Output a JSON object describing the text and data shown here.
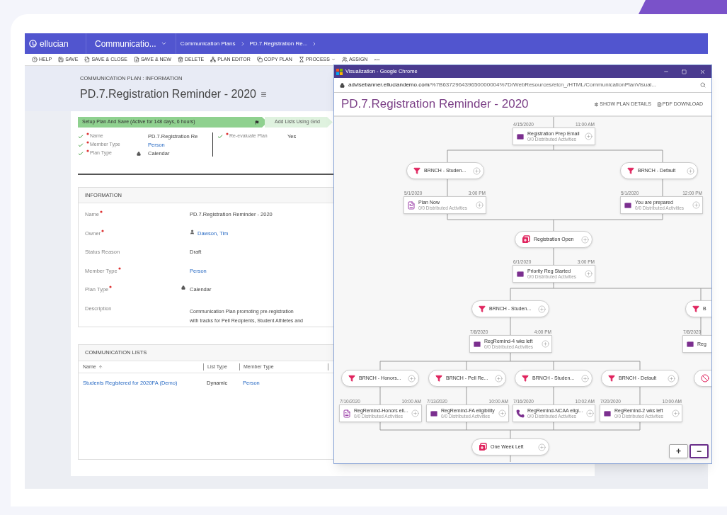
{
  "app": {
    "brand": "ellucian",
    "area": "Communicatio...",
    "breadcrumbs": [
      "Communication Plans",
      "PD.7.Registration Re..."
    ]
  },
  "toolbar": [
    {
      "label": "HELP",
      "kind": "help"
    },
    {
      "label": "SAVE",
      "kind": "save"
    },
    {
      "label": "SAVE & CLOSE",
      "kind": "save-close"
    },
    {
      "label": "SAVE & NEW",
      "kind": "save-new"
    },
    {
      "label": "DELETE",
      "kind": "delete"
    },
    {
      "label": "PLAN EDITOR",
      "kind": "editor"
    },
    {
      "label": "COPY PLAN",
      "kind": "copy"
    },
    {
      "label": "PROCESS",
      "kind": "process"
    },
    {
      "label": "ASSIGN",
      "kind": "assign"
    },
    {
      "kind": "more"
    }
  ],
  "header": {
    "entity": "COMMUNICATION PLAN : INFORMATION",
    "title": "PD.7.Registration Reminder - 2020"
  },
  "process": {
    "stages": [
      {
        "label": "Setup Plan And Save (Active for 148 days, 6 hours)",
        "selected": true
      },
      {
        "label": "Add Lists Using Grid",
        "selected": false
      }
    ],
    "fields": [
      {
        "label": "Name",
        "value": "PD.7.Registration Re",
        "kind": "text",
        "complete": true,
        "required": true
      },
      {
        "label": "Member Type",
        "value": "Person",
        "kind": "link",
        "complete": true,
        "required": true
      },
      {
        "label": "Plan Type",
        "value": "Calendar",
        "kind": "locked",
        "complete": true,
        "required": true
      },
      {
        "label": "Re-evaluate Plan",
        "value": "Yes",
        "kind": "text",
        "complete": true,
        "required": true
      }
    ]
  },
  "information": {
    "title": "INFORMATION",
    "fields": [
      {
        "label": "Name",
        "required": true,
        "kind": "text",
        "lines": [
          "PD.7.Registration Reminder - 2020"
        ]
      },
      {
        "label": "Owner",
        "required": true,
        "kind": "user",
        "lines": [
          "Dawson, Tim"
        ]
      },
      {
        "label": "Status Reason",
        "required": false,
        "kind": "text",
        "lines": [
          "Draft"
        ]
      },
      {
        "label": "Member Type",
        "required": true,
        "kind": "link",
        "lines": [
          "Person"
        ]
      },
      {
        "label": "Plan Type",
        "required": true,
        "kind": "locked",
        "lines": [
          "Calendar"
        ]
      },
      {
        "label": "Description",
        "required": false,
        "kind": "multiline",
        "lines": [
          "Communication Plan promoting pre-registration",
          "with tracks for Pell Recipients, Student Athletes and"
        ]
      }
    ]
  },
  "lists": {
    "title": "COMMUNICATION LISTS",
    "columns": [
      "Name",
      "List Type",
      "Member Type"
    ],
    "rows": [
      {
        "cells": [
          {
            "text": "Students Registered for 2020FA (Demo)",
            "kind": "link"
          },
          {
            "text": "Dynamic",
            "kind": "text"
          },
          {
            "text": "Person",
            "kind": "link"
          }
        ]
      }
    ]
  },
  "popup": {
    "window_title": "Visualization - Google Chrome",
    "url_domain": "advisebanner.elluciandemo.com",
    "url_path": "/%7B637296439650000004%7D/WebResources/elcn_/HTML/CommunicationPlanVisual...",
    "title": "PD.7.Registration Reminder - 2020",
    "actions": [
      {
        "label": "SHOW PLAN DETAILS",
        "kind": "settings"
      },
      {
        "label": "PDF DOWNLOAD",
        "kind": "pdf"
      }
    ],
    "nodes": [
      {
        "kind": "email",
        "label": "Registration Prep Email",
        "sub": "0/0 Distributed Activities",
        "date": "4/15/2020",
        "time": "11:00 AM"
      },
      {
        "kind": "branch",
        "label": "BRNCH - Studen..."
      },
      {
        "kind": "branch",
        "label": "BRNCH - Default"
      },
      {
        "kind": "letter",
        "label": "Plan Now",
        "sub": "0/0 Distributed Activities",
        "date": "5/1/2020",
        "time": "3:00 PM"
      },
      {
        "kind": "email",
        "label": "You are prepared",
        "sub": "0/0 Distributed Activities",
        "date": "5/1/2020",
        "time": "12:00 PM"
      },
      {
        "kind": "milestone",
        "label": "Registration Open"
      },
      {
        "kind": "email",
        "label": "Priority Reg Started",
        "sub": "0/0 Distributed Activities",
        "date": "6/1/2020",
        "time": "3:00 PM"
      },
      {
        "kind": "branch",
        "label": "BRNCH - Studen..."
      },
      {
        "kind": "branch",
        "label": "B"
      },
      {
        "kind": "email",
        "label": "RegRemind-4 wks left",
        "sub": "0/0 Distributed Activities",
        "date": "7/8/2020",
        "time": "4:00 PM"
      },
      {
        "kind": "email",
        "label": "Reg",
        "date": "7/8/2020"
      },
      {
        "kind": "branch",
        "label": "BRNCH - Honors..."
      },
      {
        "kind": "branch",
        "label": "BRNCH - Pell Re..."
      },
      {
        "kind": "branch",
        "label": "BRNCH - Studen..."
      },
      {
        "kind": "branch",
        "label": "BRNCH - Default"
      },
      {
        "kind": "blocked"
      },
      {
        "kind": "letter",
        "label": "RegRemind-Honors eli...",
        "sub": "0/0 Distributed Activities",
        "date": "7/10/2020",
        "time": "10:00 AM"
      },
      {
        "kind": "email",
        "label": "RegRemind-FA eligibility",
        "sub": "0/0 Distributed Activities",
        "date": "7/13/2020",
        "time": "10:00 AM"
      },
      {
        "kind": "phone",
        "label": "RegRemind-NCAA eligi...",
        "sub": "0/0 Distributed Activities",
        "date": "7/16/2020",
        "time": "10:02 AM"
      },
      {
        "kind": "email",
        "label": "RegRemind-2 wks left",
        "sub": "0/0 Distributed Activities",
        "date": "7/20/2020",
        "time": "10:00 AM"
      },
      {
        "kind": "milestone",
        "label": "One Week Left"
      }
    ],
    "zoom": [
      {
        "label": "+",
        "selected": false
      },
      {
        "label": "−",
        "selected": true
      }
    ]
  }
}
